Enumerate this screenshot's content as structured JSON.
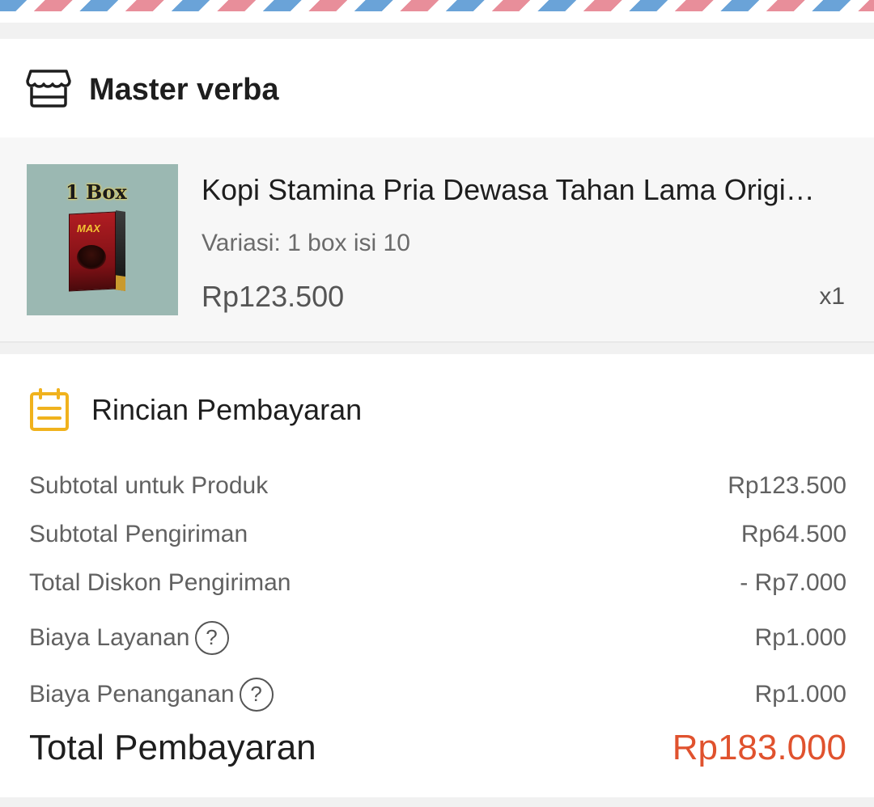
{
  "shop": {
    "name": "Master verba",
    "icon": "store-icon"
  },
  "product": {
    "thumbnail_label": "1 Box",
    "thumbnail_brand": "MAX",
    "title": "Kopi Stamina Pria Dewasa Tahan Lama Origi…",
    "variant": "Variasi: 1 box isi 10",
    "price": "Rp123.500",
    "quantity": "x1"
  },
  "payment": {
    "icon": "receipt-icon",
    "title": "Rincian Pembayaran",
    "lines": [
      {
        "label": "Subtotal untuk Produk",
        "value": "Rp123.500",
        "help": false
      },
      {
        "label": "Subtotal Pengiriman",
        "value": "Rp64.500",
        "help": false
      },
      {
        "label": "Total Diskon Pengiriman",
        "value": "- Rp7.000",
        "help": false
      },
      {
        "label": "Biaya Layanan",
        "value": "Rp1.000",
        "help": true
      },
      {
        "label": "Biaya Penanganan",
        "value": "Rp1.000",
        "help": true
      }
    ],
    "help_glyph": "?",
    "total_label": "Total Pembayaran",
    "total_value": "Rp183.000"
  },
  "colors": {
    "accent_total": "#e0522e",
    "receipt_icon": "#f0b21d",
    "stripe_red": "#e88e9a",
    "stripe_blue": "#6aa3d8"
  }
}
